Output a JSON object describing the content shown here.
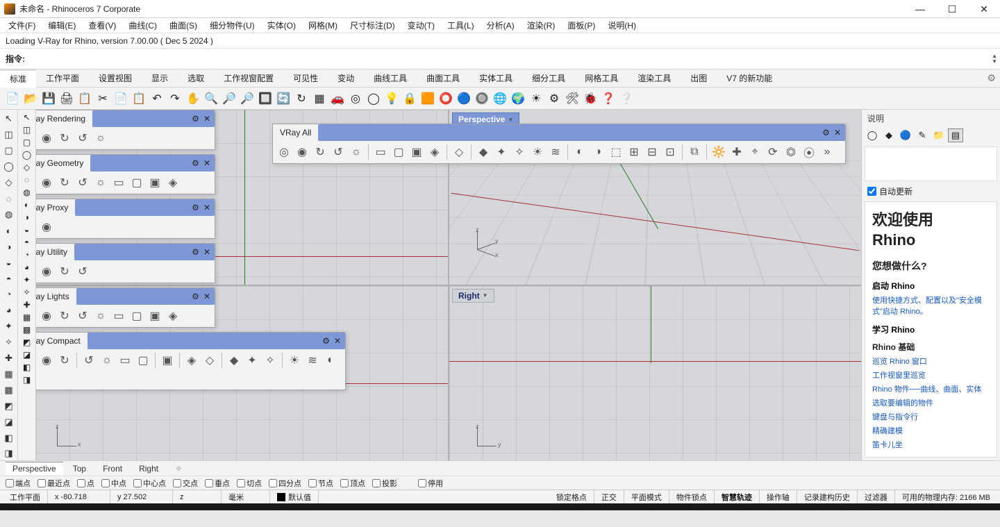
{
  "window": {
    "title": "未命名 - Rhinoceros 7 Corporate"
  },
  "menu": {
    "items": [
      "文件(F)",
      "编辑(E)",
      "查看(V)",
      "曲线(C)",
      "曲面(S)",
      "细分物件(U)",
      "实体(O)",
      "网格(M)",
      "尺寸标注(D)",
      "变动(T)",
      "工具(L)",
      "分析(A)",
      "渲染(R)",
      "面板(P)",
      "说明(H)"
    ]
  },
  "log": {
    "line": "Loading V-Ray for Rhino, version 7.00.00 ( Dec  5 2024 )"
  },
  "command": {
    "label": "指令:",
    "value": ""
  },
  "tabs": {
    "items": [
      "标准",
      "工作平面",
      "设置视图",
      "显示",
      "选取",
      "工作视窗配置",
      "可见性",
      "变动",
      "曲线工具",
      "曲面工具",
      "实体工具",
      "细分工具",
      "网格工具",
      "渲染工具",
      "出图",
      "V7 的新功能"
    ],
    "active_index": 0
  },
  "standard_toolbar_icons": [
    "new-file-icon",
    "open-file-icon",
    "save-icon",
    "print-icon",
    "properties-icon",
    "cut-icon",
    "copy-icon",
    "paste-icon",
    "undo-icon",
    "redo-icon",
    "pan-icon",
    "zoom-icon",
    "zoom-extents-icon",
    "zoom-selected-icon",
    "zoom-window-icon",
    "rotate-view-icon",
    "refresh-icon",
    "grid-icon",
    "render-icon",
    "render-preview-icon",
    "hide-icon",
    "show-icon",
    "lock-icon",
    "layer-icon",
    "material-icon",
    "appearance-icon",
    "shade-icon",
    "globe-icon",
    "world-icon",
    "sun-icon",
    "gear-icon",
    "options-icon",
    "grasshopper-icon",
    "vray-icon",
    "help-icon"
  ],
  "standard_toolbar_glyphs": [
    "📄",
    "📂",
    "💾",
    "🖨",
    "📋",
    "✂",
    "📄",
    "📋",
    "↶",
    "↷",
    "✋",
    "🔍",
    "🔎",
    "🔎",
    "🔲",
    "🔄",
    "↻",
    "▦",
    "🚗",
    "◎",
    "◯",
    "💡",
    "🔒",
    "🟧",
    "⭕",
    "🔵",
    "🔘",
    "🌐",
    "🌍",
    "☀",
    "⚙",
    "🛠",
    "🐞",
    "❓",
    "❔"
  ],
  "viewports": {
    "tl": {
      "label": ""
    },
    "tr": {
      "label": "Perspective"
    },
    "bl": {
      "label": ""
    },
    "br": {
      "label": "Right"
    }
  },
  "vray_toolbars": {
    "rendering": {
      "title": "VRay Rendering",
      "icon_count": 5
    },
    "geometry": {
      "title": "VRay Geometry",
      "icon_count": 9
    },
    "proxy": {
      "title": "VRay Proxy",
      "icon_count": 2
    },
    "utility": {
      "title": "VRay Utility",
      "icon_count": 4
    },
    "lights": {
      "title": "VRay Lights",
      "icon_count": 9
    },
    "compact": {
      "title": "VRay Compact",
      "icon_count": 17
    },
    "all": {
      "title": "VRay All",
      "icon_count": 28,
      "overflow": true
    }
  },
  "rightpanel": {
    "title": "说明",
    "auto_update": "自动更新",
    "welcome_h1a": "欢迎使用",
    "welcome_h1b": "Rhino",
    "q": "您想做什么?",
    "start_label": "启动 Rhino",
    "start_link": "使用快捷方式、配置以及\"安全模式\"启动 Rhino。",
    "learn_label": "学习 Rhino",
    "basics_label": "Rhino 基础",
    "links": [
      "巡览 Rhino 窗口",
      "工作视窗里巡览",
      "Rhino 物件──曲线、曲面、实体",
      "选取要编辑的物件",
      "键盘与指令行",
      "精确建模",
      "笛卡儿坐"
    ]
  },
  "vp_tabs": {
    "items": [
      "Perspective",
      "Top",
      "Front",
      "Right"
    ],
    "active_index": 0
  },
  "osnap": {
    "items": [
      "端点",
      "最近点",
      "点",
      "中点",
      "中心点",
      "交点",
      "垂点",
      "切点",
      "四分点",
      "节点",
      "顶点",
      "投影",
      "停用"
    ]
  },
  "status": {
    "plane": "工作平面",
    "x": "x -80.718",
    "y": "y 27.502",
    "z": "z",
    "units": "毫米",
    "layer": "默认值",
    "cells": [
      "锁定格点",
      "正交",
      "平面模式",
      "物件锁点",
      "智慧轨迹",
      "操作轴",
      "记录建构历史",
      "过滤器"
    ],
    "bold_cell": "智慧轨迹",
    "mem": "可用的物理内存: 2166 MB"
  },
  "dark_strip": ""
}
